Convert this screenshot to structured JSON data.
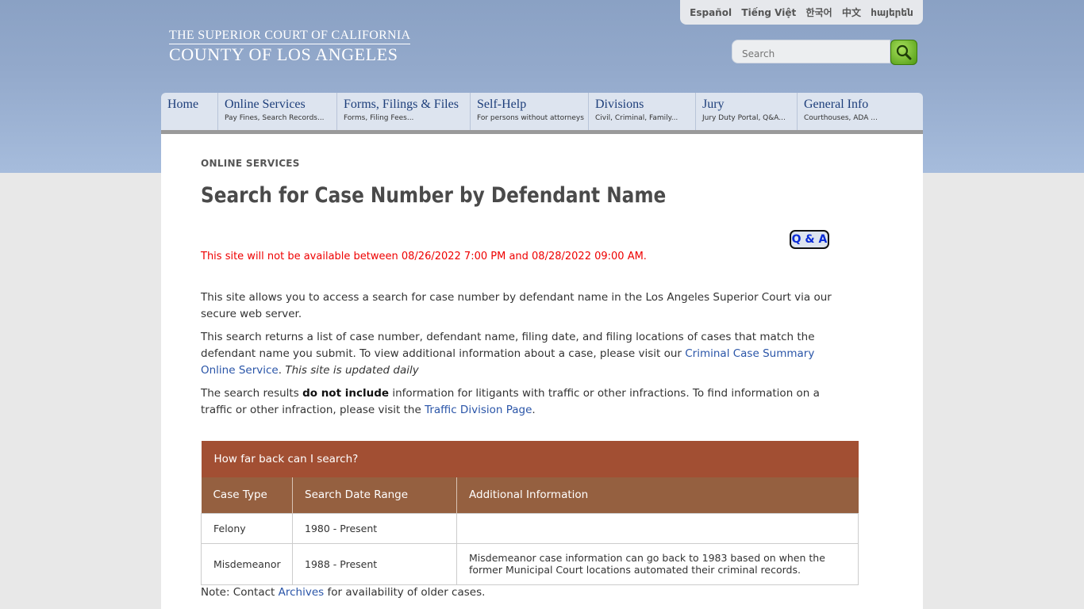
{
  "header": {
    "languages": [
      "Español",
      "Tiếng Việt",
      "한국어",
      "中文",
      "հայերեն"
    ],
    "logo_line1": "THE SUPERIOR COURT OF CALIFORNIA",
    "logo_line2": "COUNTY OF LOS ANGELES",
    "search_placeholder": "Search"
  },
  "nav": [
    {
      "title": "Home",
      "subtitle": ""
    },
    {
      "title": "Online Services",
      "subtitle": "Pay Fines, Search Records..."
    },
    {
      "title": "Forms, Filings & Files",
      "subtitle": "Forms, Filing Fees..."
    },
    {
      "title": "Self-Help",
      "subtitle": "For persons without attorneys"
    },
    {
      "title": "Divisions",
      "subtitle": "Civil, Criminal, Family..."
    },
    {
      "title": "Jury",
      "subtitle": "Jury Duty Portal, Q&A..."
    },
    {
      "title": "General Info",
      "subtitle": "Courthouses, ADA ..."
    }
  ],
  "page": {
    "breadcrumb": "ONLINE SERVICES",
    "title": "Search for Case Number by Defendant Name",
    "qa_label": "Q & A",
    "alert": "This site will not be available between 08/26/2022 7:00 PM and 08/28/2022 09:00 AM.",
    "p1": "This site allows you to access a search for case number by defendant name in the Los Angeles Superior Court via our secure web server.",
    "p2_a": "This search returns a list of case number, defendant name, filing date, and filing locations of cases that match the defendant name you submit.  To view additional information about a case, please visit our ",
    "p2_link": "Criminal Case Summary Online Service",
    "p2_b": ".  ",
    "p2_italic": "This site is updated daily",
    "p3_a": "The search results ",
    "p3_bold": "do not include",
    "p3_b": " information for litigants with traffic or other infractions. To find information on a traffic or other infraction, please visit the ",
    "p3_link": "Traffic Division Page",
    "p3_c": "."
  },
  "table": {
    "caption": "How far back can I search?",
    "headers": [
      "Case Type",
      "Search Date Range",
      "Additional Information"
    ],
    "rows": [
      [
        "Felony",
        "1980 - Present",
        ""
      ],
      [
        "Misdemeanor",
        "1988 - Present",
        "Misdemeanor case information can go back to 1983 based on when the former Municipal Court locations automated their criminal records."
      ]
    ]
  },
  "note": {
    "prefix": "Note: Contact ",
    "link": "Archives",
    "suffix": " for availability of older cases."
  },
  "colors": {
    "accent_red": "#a24f33",
    "header_brown": "#956040",
    "link_blue": "#2a55a8",
    "alert_red": "#e00000"
  }
}
